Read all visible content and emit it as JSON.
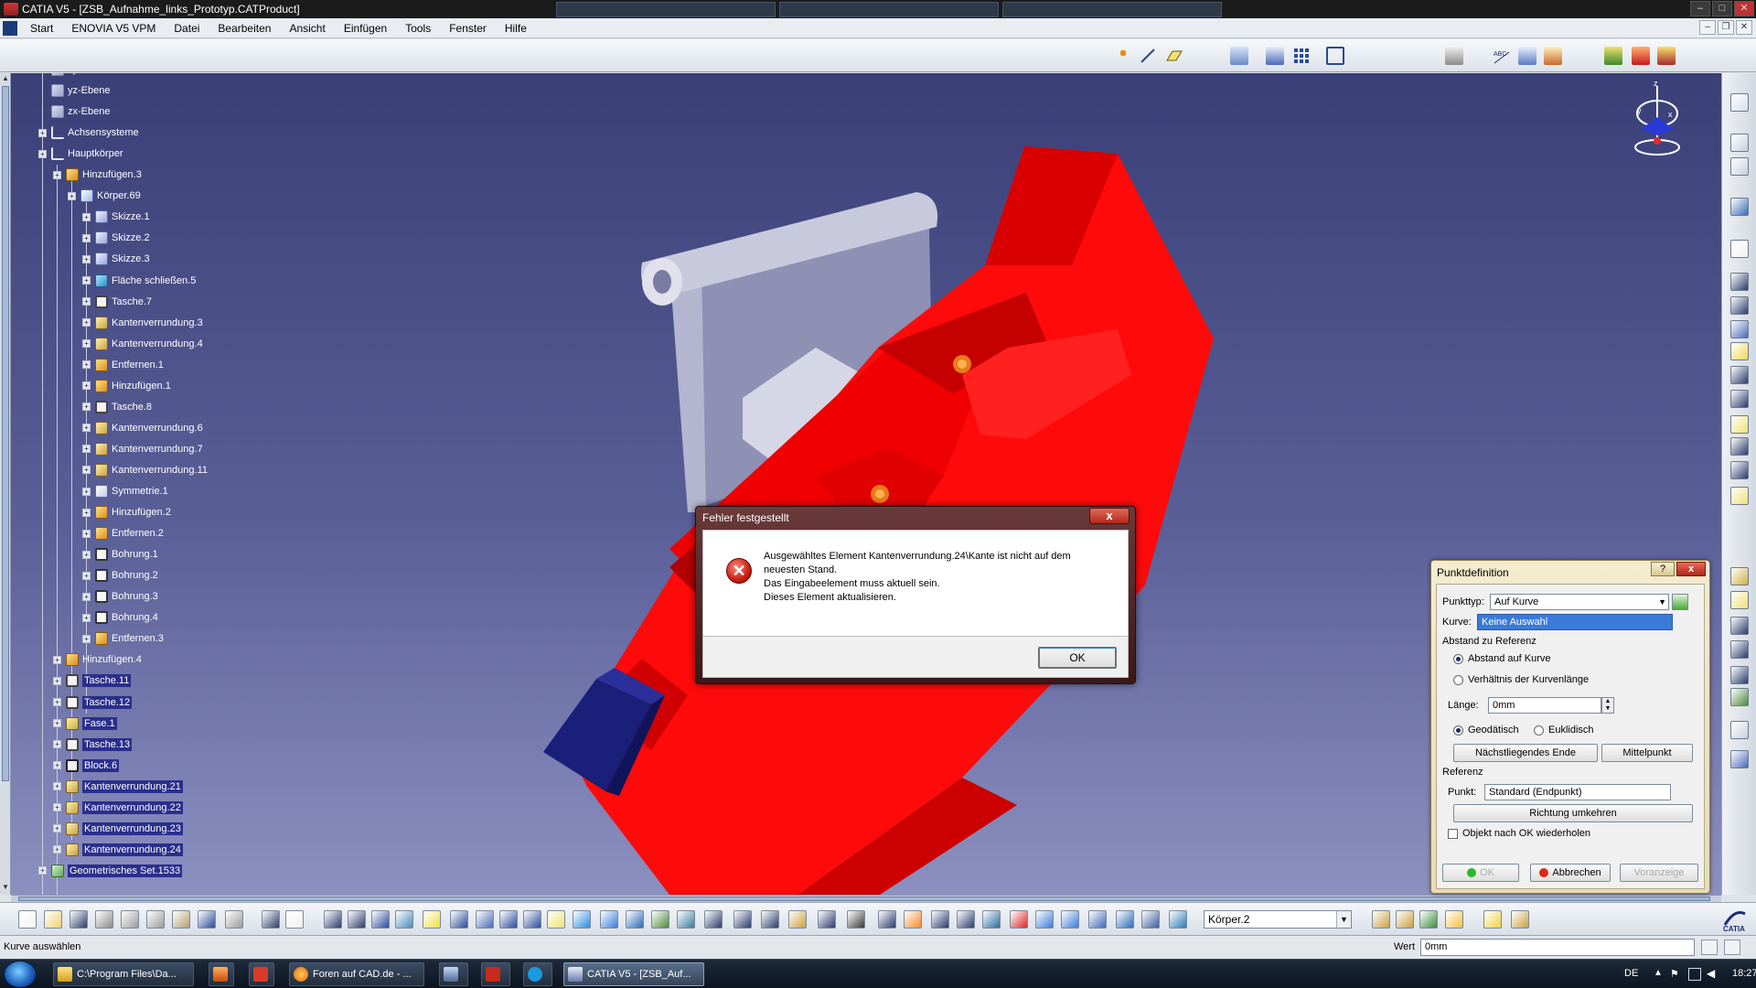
{
  "window": {
    "title": "CATIA V5 - [ZSB_Aufnahme_links_Prototyp.CATProduct]",
    "controls": [
      "–",
      "□",
      "✕"
    ]
  },
  "menu": {
    "items": [
      "Start",
      "ENOVIA V5 VPM",
      "Datei",
      "Bearbeiten",
      "Ansicht",
      "Einfügen",
      "Tools",
      "Fenster",
      "Hilfe"
    ]
  },
  "tree": {
    "nodes": [
      {
        "label": "xy-Ebene",
        "icon": "plane-icon"
      },
      {
        "label": "yz-Ebene",
        "icon": "plane-icon"
      },
      {
        "label": "zx-Ebene",
        "icon": "plane-icon"
      },
      {
        "label": "Achsensysteme",
        "icon": "axis-icon"
      },
      {
        "label": "Hauptkörper",
        "icon": "axis-icon"
      },
      {
        "label": "Hinzufügen.3",
        "icon": "add-icon"
      },
      {
        "label": "Körper.69",
        "icon": "body-icon"
      },
      {
        "label": "Skizze.1",
        "icon": "sketch-icon"
      },
      {
        "label": "Skizze.2",
        "icon": "sketch-icon"
      },
      {
        "label": "Skizze.3",
        "icon": "sketch-icon"
      },
      {
        "label": "Fläche schließen.5",
        "icon": "surface-icon"
      },
      {
        "label": "Tasche.7",
        "icon": "pocket-icon"
      },
      {
        "label": "Kantenverrundung.3",
        "icon": "fillet-icon"
      },
      {
        "label": "Kantenverrundung.4",
        "icon": "fillet-icon"
      },
      {
        "label": "Entfernen.1",
        "icon": "remove-icon"
      },
      {
        "label": "Hinzufügen.1",
        "icon": "add-icon"
      },
      {
        "label": "Tasche.8",
        "icon": "pocket-icon"
      },
      {
        "label": "Kantenverrundung.6",
        "icon": "fillet-icon"
      },
      {
        "label": "Kantenverrundung.7",
        "icon": "fillet-icon"
      },
      {
        "label": "Kantenverrundung.11",
        "icon": "fillet-icon"
      },
      {
        "label": "Symmetrie.1",
        "icon": "symmetry-icon"
      },
      {
        "label": "Hinzufügen.2",
        "icon": "add-icon"
      },
      {
        "label": "Entfernen.2",
        "icon": "remove-icon"
      },
      {
        "label": "Bohrung.1",
        "icon": "hole-icon"
      },
      {
        "label": "Bohrung.2",
        "icon": "hole-icon"
      },
      {
        "label": "Bohrung.3",
        "icon": "hole-icon"
      },
      {
        "label": "Bohrung.4",
        "icon": "hole-icon"
      },
      {
        "label": "Entfernen.3",
        "icon": "remove-icon"
      },
      {
        "label": "Hinzufügen.4",
        "icon": "add-icon"
      },
      {
        "label": "Tasche.11",
        "icon": "pocket-icon"
      },
      {
        "label": "Tasche.12",
        "icon": "pocket-icon"
      },
      {
        "label": "Fase.1",
        "icon": "chamfer-icon"
      },
      {
        "label": "Tasche.13",
        "icon": "pocket-icon"
      },
      {
        "label": "Block.6",
        "icon": "block-icon"
      },
      {
        "label": "Kantenverrundung.21",
        "icon": "fillet-icon"
      },
      {
        "label": "Kantenverrundung.22",
        "icon": "fillet-icon"
      },
      {
        "label": "Kantenverrundung.23",
        "icon": "fillet-icon"
      },
      {
        "label": "Kantenverrundung.24",
        "icon": "fillet-icon"
      },
      {
        "label": "Geometrisches Set.1533",
        "icon": "geoset-icon"
      }
    ]
  },
  "error_dialog": {
    "title": "Fehler festgestellt",
    "close": "x",
    "lines": [
      "Ausgewähltes Element Kantenverrundung.24\\Kante ist nicht auf dem",
      "neuesten Stand.",
      "Das Eingabeelement muss aktuell sein.",
      "Dieses Element aktualisieren."
    ],
    "ok": "OK"
  },
  "punkt_dialog": {
    "title": "Punktdefinition",
    "help": "?",
    "close": "x",
    "punkttyp_label": "Punkttyp:",
    "punkttyp_value": "Auf Kurve",
    "kurve_label": "Kurve:",
    "kurve_value": "Keine Auswahl",
    "abstand_group": "Abstand zu Referenz",
    "radio_abstand": "Abstand auf Kurve",
    "radio_verhaeltnis": "Verhältnis der Kurvenlänge",
    "laenge_label": "Länge:",
    "laenge_value": "0mm",
    "radio_geodaetisch": "Geodätisch",
    "radio_euklidisch": "Euklidisch",
    "btn_naechstes": "Nächstliegendes Ende",
    "btn_mittelpunkt": "Mittelpunkt",
    "referenz_group": "Referenz",
    "punkt_label": "Punkt:",
    "punkt_value": "Standard (Endpunkt)",
    "btn_richtung": "Richtung umkehren",
    "checkbox_label": "Objekt nach OK wiederholen",
    "btn_ok": "OK",
    "btn_abbrechen": "Abbrechen",
    "btn_voranzeige": "Voranzeige"
  },
  "bottom_toolbar": {
    "body_select": "Körper.2"
  },
  "statusbar": {
    "text": "Kurve auswählen",
    "wert_label": "Wert",
    "wert_value": "0mm"
  },
  "taskbar": {
    "items": [
      "C:\\Program Files\\Da...",
      "Foren auf CAD.de - ...",
      "CATIA V5 - [ZSB_Auf..."
    ],
    "lang": "DE",
    "time": "18:27"
  },
  "colors": {
    "part_red": "#ff0a0a",
    "viewport_top": "#3a3f78",
    "viewport_bottom": "#8c90c0"
  }
}
